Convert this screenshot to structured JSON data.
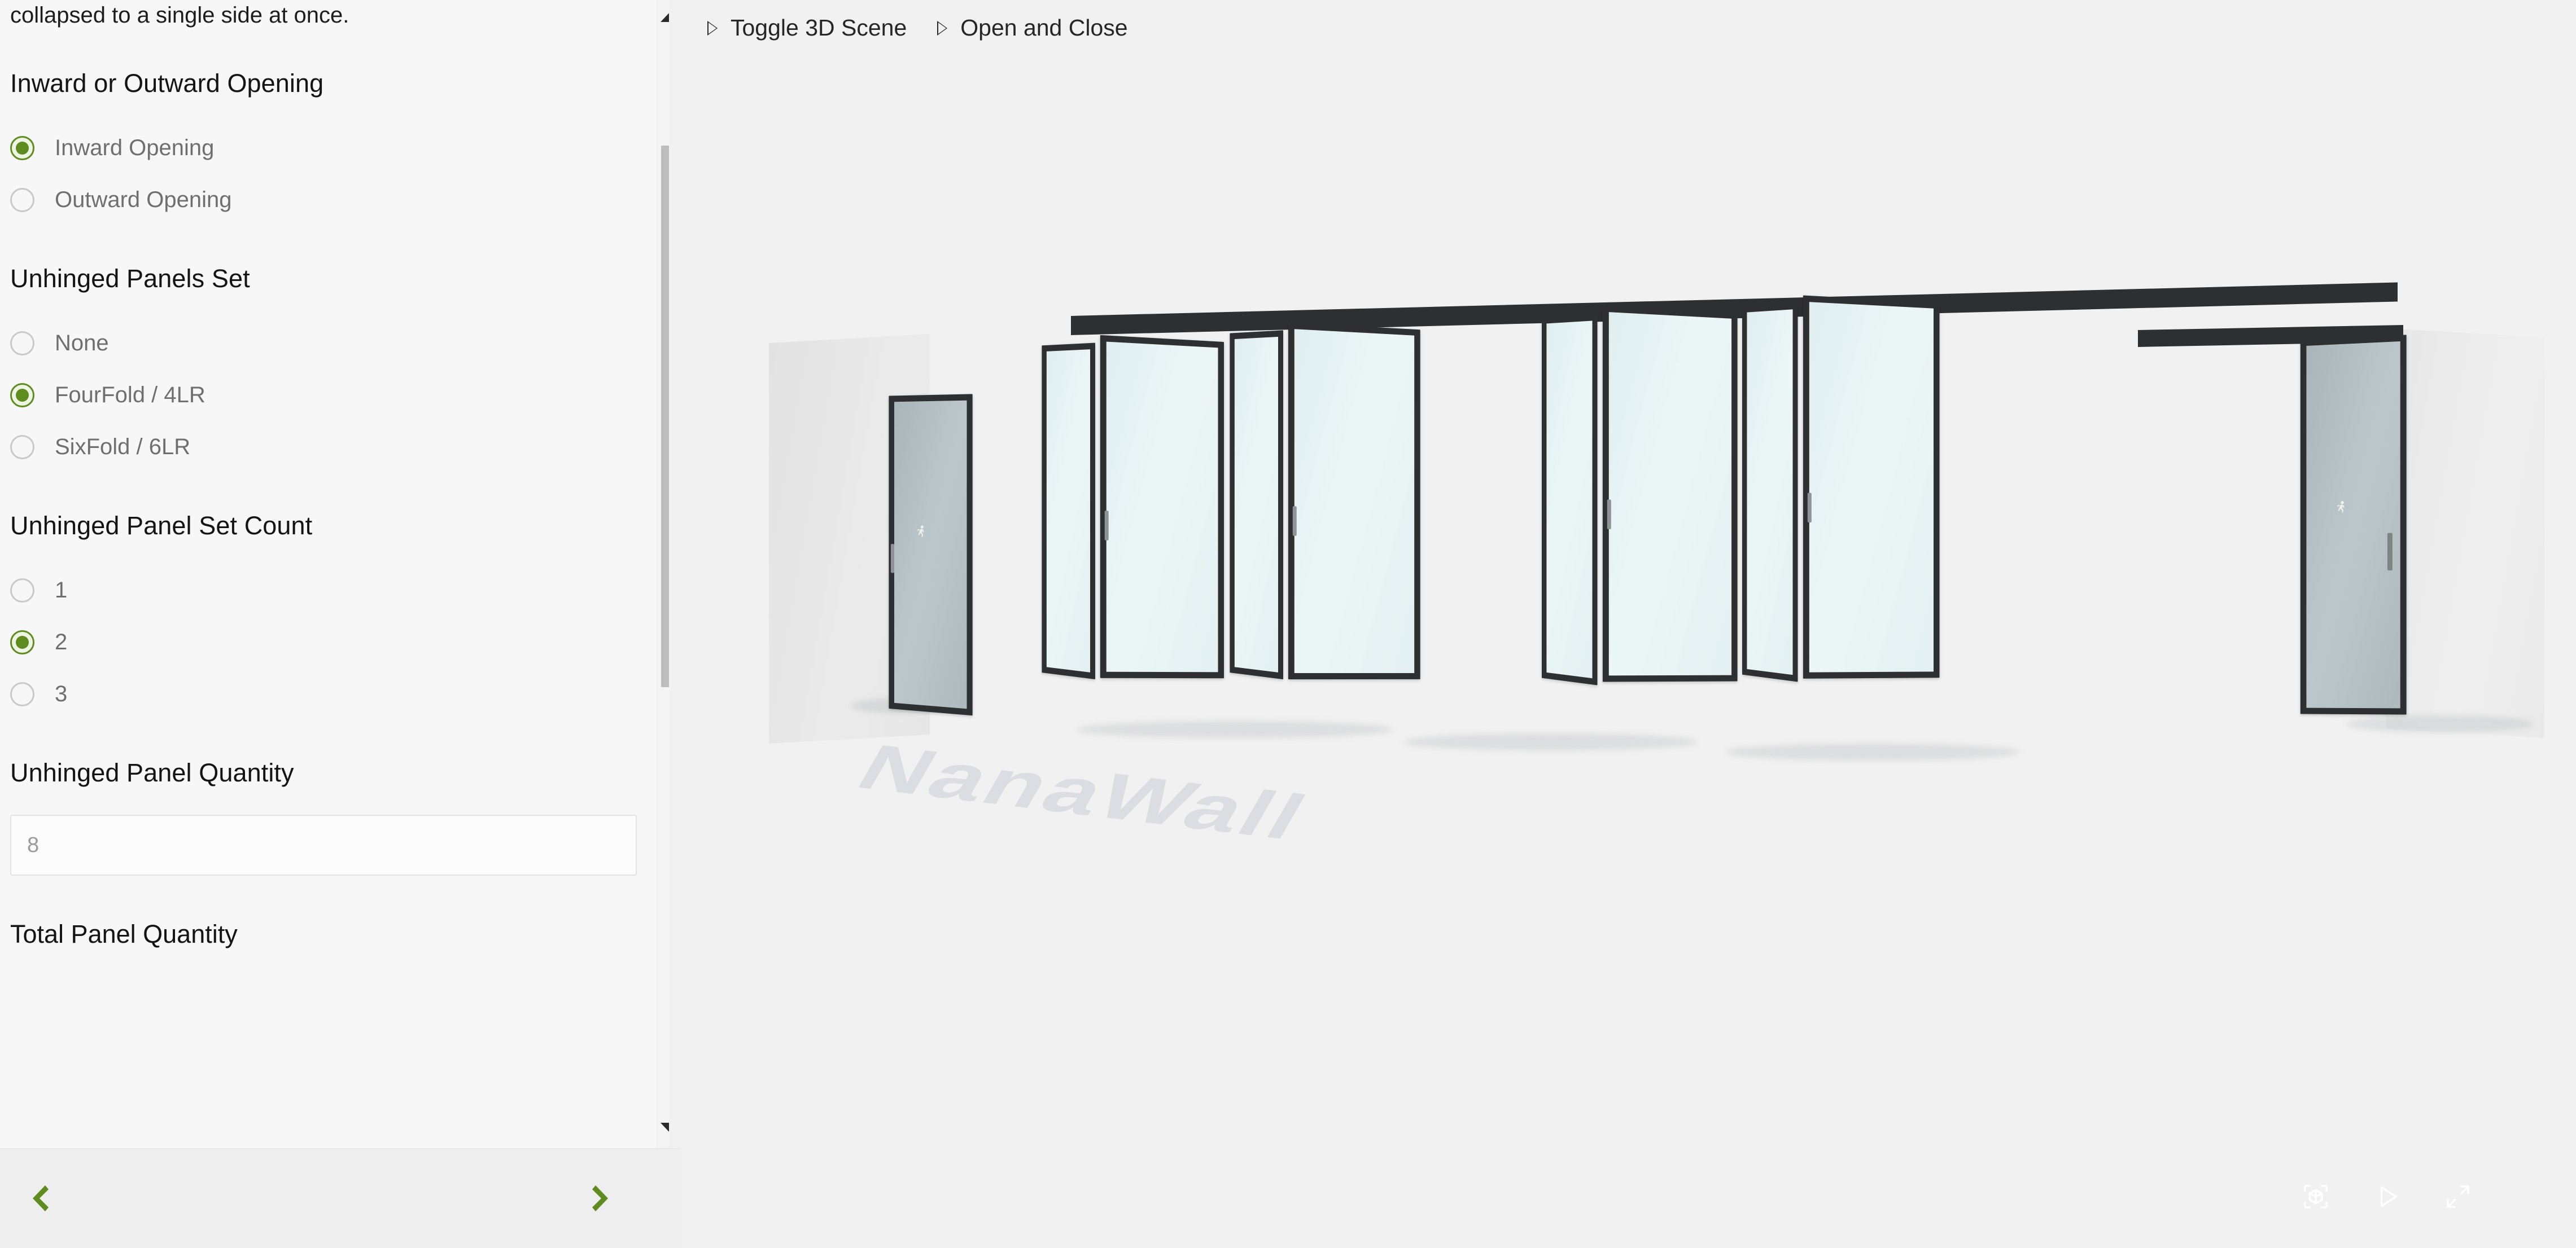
{
  "config_panel": {
    "intro_text": "collapsed to a single side at once.",
    "groups": [
      {
        "title": "Inward or Outward Opening",
        "options": [
          {
            "label": "Inward Opening",
            "selected": true
          },
          {
            "label": "Outward Opening",
            "selected": false
          }
        ]
      },
      {
        "title": "Unhinged Panels Set",
        "options": [
          {
            "label": "None",
            "selected": false
          },
          {
            "label": "FourFold / 4LR",
            "selected": true
          },
          {
            "label": "SixFold / 6LR",
            "selected": false
          }
        ]
      },
      {
        "title": "Unhinged Panel Set Count",
        "options": [
          {
            "label": "1",
            "selected": false
          },
          {
            "label": "2",
            "selected": true
          },
          {
            "label": "3",
            "selected": false
          }
        ]
      }
    ],
    "quantity_field": {
      "title": "Unhinged Panel Quantity",
      "value": "8",
      "placeholder": "8"
    },
    "next_section_title": "Total Panel Quantity",
    "scrollbar": {
      "up_arrow_icon": "triangle-up-icon",
      "down_arrow_icon": "triangle-down-icon"
    },
    "footer": {
      "prev_label": "Previous step",
      "next_label": "Next step",
      "prev_icon": "chevron-left-icon",
      "next_icon": "chevron-right-icon",
      "accent_color": "#5e8c1f"
    }
  },
  "viewer": {
    "toolbar": [
      {
        "label": "Toggle 3D Scene",
        "icon": "play-triangle-outline-icon"
      },
      {
        "label": "Open and Close",
        "icon": "play-triangle-outline-icon"
      }
    ],
    "floor_logo": "NanaWall",
    "controls": [
      {
        "name": "orbit-3d-icon",
        "title": "3D view"
      },
      {
        "name": "play-icon",
        "title": "Play animation"
      },
      {
        "name": "fullscreen-expand-icon",
        "title": "Fullscreen"
      }
    ],
    "scene": {
      "product": "Folding glass wall system",
      "frame_color": "#2d2f31",
      "glass_color": "#e6f2f3",
      "frosted_glass_color": "#b0bbbf",
      "background_color": "#f1f1f1",
      "swing_door_panels": 2,
      "folding_panels": 8
    }
  }
}
